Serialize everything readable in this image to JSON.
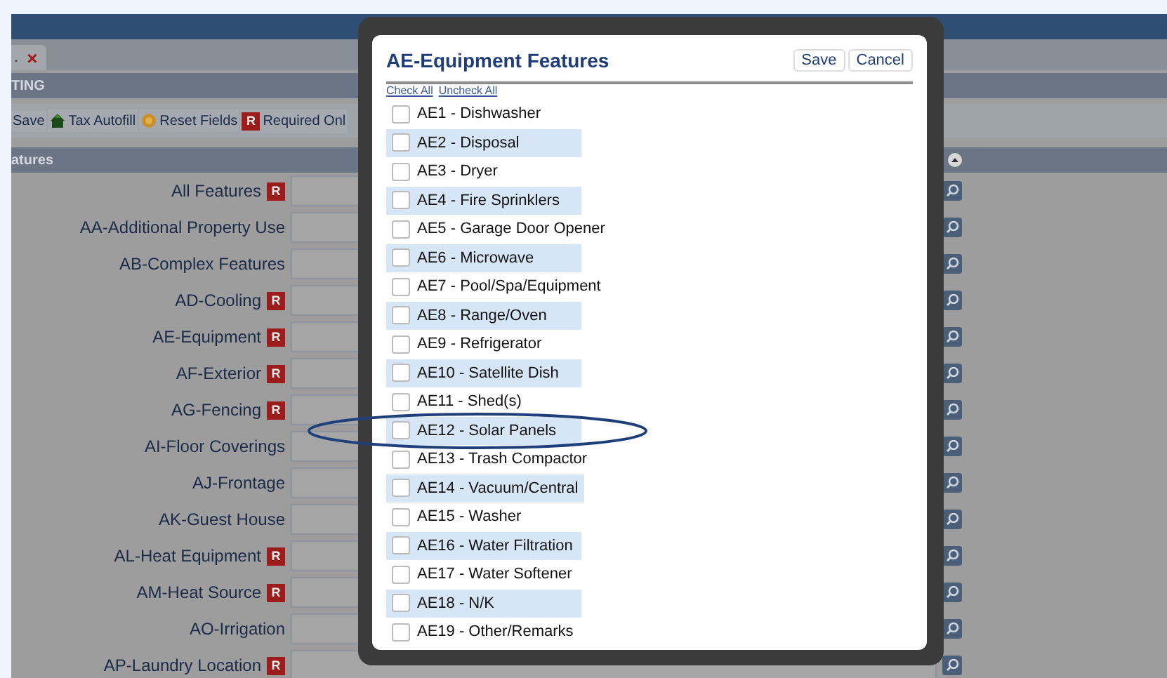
{
  "tab": {
    "label": ".",
    "close": "×"
  },
  "section_title": "TING",
  "toolbar": [
    {
      "kind": "save",
      "label": "Save"
    },
    {
      "kind": "autofill",
      "label": "Tax Autofill"
    },
    {
      "kind": "reset",
      "label": "Reset Fields"
    },
    {
      "kind": "required",
      "badge": "R",
      "label": "Required Onl"
    }
  ],
  "features_header": "atures",
  "fields": [
    {
      "label": "All Features",
      "required": true,
      "badge": "R"
    },
    {
      "label": "AA-Additional Property Use",
      "required": false
    },
    {
      "label": "AB-Complex Features",
      "required": false
    },
    {
      "label": "AD-Cooling",
      "required": true,
      "badge": "R"
    },
    {
      "label": "AE-Equipment",
      "required": true,
      "badge": "R"
    },
    {
      "label": "AF-Exterior",
      "required": true,
      "badge": "R"
    },
    {
      "label": "AG-Fencing",
      "required": true,
      "badge": "R"
    },
    {
      "label": "AI-Floor Coverings",
      "required": false
    },
    {
      "label": "AJ-Frontage",
      "required": false
    },
    {
      "label": "AK-Guest House",
      "required": false
    },
    {
      "label": "AL-Heat Equipment",
      "required": true,
      "badge": "R"
    },
    {
      "label": "AM-Heat Source",
      "required": true,
      "badge": "R"
    },
    {
      "label": "AO-Irrigation",
      "required": false
    },
    {
      "label": "AP-Laundry Location",
      "required": true,
      "badge": "R"
    }
  ],
  "dialog": {
    "title": "AE-Equipment Features",
    "buttons": [
      "Save",
      "Cancel"
    ],
    "links": [
      "Check All",
      "Uncheck All"
    ],
    "items": [
      {
        "label": "AE1 - Dishwasher",
        "checked": false,
        "circled": false
      },
      {
        "label": "AE2 - Disposal",
        "checked": false,
        "circled": false
      },
      {
        "label": "AE3 - Dryer",
        "checked": false,
        "circled": false
      },
      {
        "label": "AE4 - Fire Sprinklers",
        "checked": false,
        "circled": false
      },
      {
        "label": "AE5 - Garage Door Opener",
        "checked": false,
        "circled": false
      },
      {
        "label": "AE6 - Microwave",
        "checked": false,
        "circled": false
      },
      {
        "label": "AE7 - Pool/Spa/Equipment",
        "checked": false,
        "circled": false
      },
      {
        "label": "AE8 - Range/Oven",
        "checked": false,
        "circled": false
      },
      {
        "label": "AE9 - Refrigerator",
        "checked": false,
        "circled": false
      },
      {
        "label": "AE10 - Satellite Dish",
        "checked": false,
        "circled": false
      },
      {
        "label": "AE11 - Shed(s)",
        "checked": false,
        "circled": false
      },
      {
        "label": "AE12 - Solar Panels",
        "checked": false,
        "circled": true
      },
      {
        "label": "AE13 - Trash Compactor",
        "checked": false,
        "circled": false
      },
      {
        "label": "AE14 - Vacuum/Central",
        "checked": false,
        "circled": false
      },
      {
        "label": "AE15 - Washer",
        "checked": false,
        "circled": false
      },
      {
        "label": "AE16 - Water Filtration",
        "checked": false,
        "circled": false
      },
      {
        "label": "AE17 - Water Softener",
        "checked": false,
        "circled": false
      },
      {
        "label": "AE18 - N/K",
        "checked": false,
        "circled": false
      },
      {
        "label": "AE19 - Other/Remarks",
        "checked": false,
        "circled": false
      }
    ]
  }
}
